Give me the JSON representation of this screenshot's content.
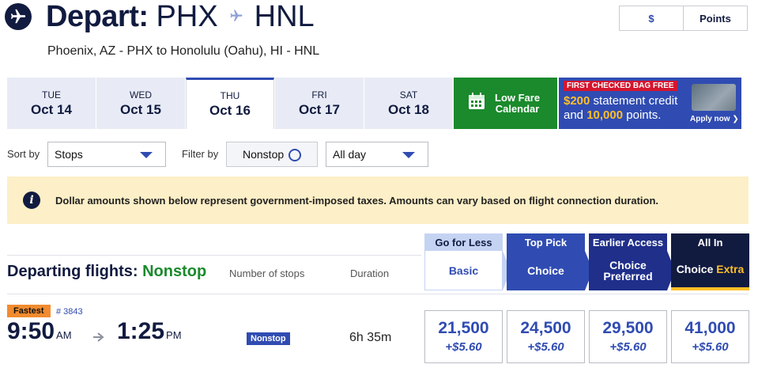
{
  "header": {
    "depart_word": "Depart:",
    "origin_code": "PHX",
    "dest_code": "HNL",
    "route": "Phoenix, AZ - PHX to Honolulu (Oahu), HI - HNL"
  },
  "currency_toggle": {
    "dollars": "$",
    "points": "Points",
    "selected": "Points"
  },
  "date_tabs": [
    {
      "dow": "TUE",
      "date": "Oct 14"
    },
    {
      "dow": "WED",
      "date": "Oct 15"
    },
    {
      "dow": "THU",
      "date": "Oct 16"
    },
    {
      "dow": "FRI",
      "date": "Oct 17"
    },
    {
      "dow": "SAT",
      "date": "Oct 18"
    }
  ],
  "low_fare": {
    "line1": "Low Fare",
    "line2": "Calendar"
  },
  "promo": {
    "flag": "FIRST CHECKED BAG FREE",
    "credit_amount": "$200",
    "credit_text": " statement credit",
    "and_text": "and ",
    "points_amount": "10,000",
    "points_text": " points.",
    "apply": "Apply now"
  },
  "sort": {
    "label": "Sort by",
    "value": "Stops"
  },
  "filter": {
    "label": "Filter by",
    "nonstop": "Nonstop",
    "time_value": "All day"
  },
  "notice": "Dollar amounts shown below represent government-imposed taxes. Amounts can vary based on flight connection duration.",
  "list_header": {
    "departing": "Departing flights: ",
    "nonstop": "Nonstop",
    "stops_col": "Number of stops",
    "duration_col": "Duration"
  },
  "fares": [
    {
      "tag": "Go for Less",
      "name": "Basic",
      "name2": ""
    },
    {
      "tag": "Top Pick",
      "name": "Choice",
      "name2": ""
    },
    {
      "tag": "Earlier Access",
      "name": "Choice",
      "name2": "Preferred"
    },
    {
      "tag": "All In",
      "name": "Choice ",
      "name2": "Extra"
    }
  ],
  "flight": {
    "badge": "Fastest",
    "number": "# 3843",
    "depart_time": "9:50",
    "depart_ampm": "AM",
    "arrive_time": "1:25",
    "arrive_ampm": "PM",
    "stops": "Nonstop",
    "duration": "6h 35m",
    "prices": [
      {
        "points": "21,500",
        "tax": "+$5.60"
      },
      {
        "points": "24,500",
        "tax": "+$5.60"
      },
      {
        "points": "29,500",
        "tax": "+$5.60"
      },
      {
        "points": "41,000",
        "tax": "+$5.60"
      }
    ]
  },
  "colors": {
    "navy": "#111b40",
    "blue": "#304cb2",
    "green": "#1a8a2c",
    "notice_bg": "#fdefc7",
    "fastest": "#f18b2e",
    "gold": "#ffbf27"
  }
}
